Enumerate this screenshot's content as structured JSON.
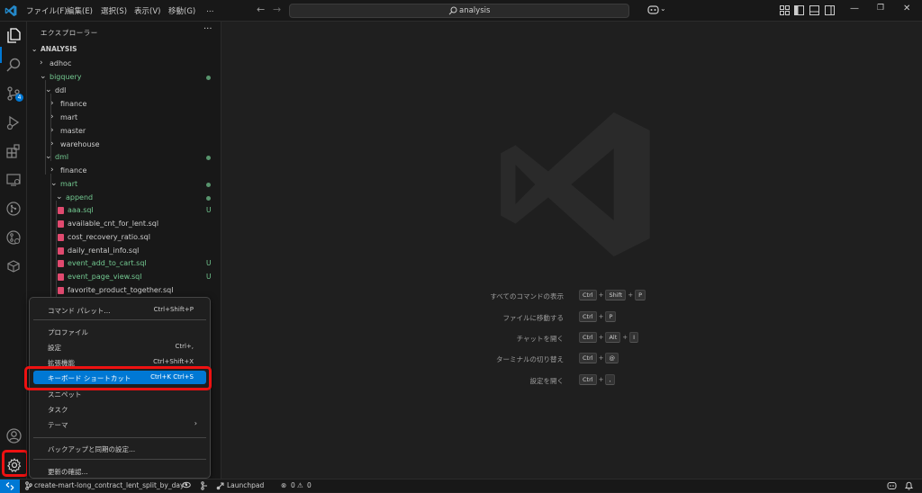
{
  "titlebar": {
    "menus": [
      "ファイル(F)",
      "編集(E)",
      "選択(S)",
      "表示(V)",
      "移動(G)",
      "…"
    ],
    "search_text": "analysis"
  },
  "activity_bar": {
    "items": [
      "explorer-icon",
      "search-icon",
      "source-control-icon",
      "run-debug-icon",
      "extensions-icon",
      "remote-explorer-icon",
      "git-graph-icon",
      "gitlens-icon",
      "database-icon"
    ],
    "scm_badge": "4",
    "bottom": [
      "account-icon",
      "manage-gear-icon"
    ]
  },
  "sidebar": {
    "title": "エクスプローラー",
    "more": "···",
    "section": "ANALYSIS",
    "tree": [
      {
        "label": "adhoc",
        "chev": "›",
        "status": ""
      },
      {
        "label": "bigquery",
        "chev": "⌄",
        "status": "dot"
      },
      {
        "label": "ddl",
        "chev": "⌄",
        "status": ""
      },
      {
        "label": "finance",
        "chev": "›",
        "status": ""
      },
      {
        "label": "mart",
        "chev": "›",
        "status": ""
      },
      {
        "label": "master",
        "chev": "›",
        "status": ""
      },
      {
        "label": "warehouse",
        "chev": "›",
        "status": ""
      },
      {
        "label": "dml",
        "chev": "⌄",
        "status": "dot"
      },
      {
        "label": "finance",
        "chev": "›",
        "status": ""
      },
      {
        "label": "mart",
        "chev": "⌄",
        "status": "dot"
      },
      {
        "label": "append",
        "chev": "⌄",
        "status": "dot"
      },
      {
        "label": "aaa.sql",
        "chev": "",
        "status": "U"
      },
      {
        "label": "available_cnt_for_lent.sql",
        "chev": "",
        "status": ""
      },
      {
        "label": "cost_recovery_ratio.sql",
        "chev": "",
        "status": ""
      },
      {
        "label": "daily_rental_info.sql",
        "chev": "",
        "status": ""
      },
      {
        "label": "event_add_to_cart.sql",
        "chev": "",
        "status": "U"
      },
      {
        "label": "event_page_view.sql",
        "chev": "",
        "status": "U"
      },
      {
        "label": "favorite_product_together.sql",
        "chev": "",
        "status": ""
      }
    ]
  },
  "editor_hints": [
    {
      "label": "すべてのコマンドの表示",
      "keys": [
        "Ctrl",
        "Shift",
        "P"
      ]
    },
    {
      "label": "ファイルに移動する",
      "keys": [
        "Ctrl",
        "P"
      ]
    },
    {
      "label": "チャットを開く",
      "keys": [
        "Ctrl",
        "Alt",
        "I"
      ]
    },
    {
      "label": "ターミナルの切り替え",
      "keys": [
        "Ctrl",
        "@"
      ]
    },
    {
      "label": "設定を開く",
      "keys": [
        "Ctrl",
        ","
      ]
    }
  ],
  "manage_menu": {
    "items": [
      {
        "label": "コマンド パレット...",
        "shortcut": "Ctrl+Shift+P"
      },
      {
        "label": "プロファイル",
        "shortcut": ""
      },
      {
        "label": "設定",
        "shortcut": "Ctrl+,"
      },
      {
        "label": "拡張機能",
        "shortcut": "Ctrl+Shift+X"
      },
      {
        "label": "キーボード ショートカット",
        "shortcut": "Ctrl+K Ctrl+S"
      },
      {
        "label": "スニペット",
        "shortcut": ""
      },
      {
        "label": "タスク",
        "shortcut": ""
      },
      {
        "label": "テーマ",
        "shortcut": ""
      },
      {
        "label": "バックアップと同期の設定...",
        "shortcut": ""
      },
      {
        "label": "更新の確認...",
        "shortcut": ""
      }
    ],
    "selected_index": 4
  },
  "statusbar": {
    "branch": "create-mart-long_contract_lent_split_by_day*",
    "launchpad": "Launchpad",
    "errors": "0",
    "warnings": "0"
  },
  "colors": {
    "accent": "#0078d4",
    "untracked": "#73c991",
    "highlight": "#ee1111"
  }
}
